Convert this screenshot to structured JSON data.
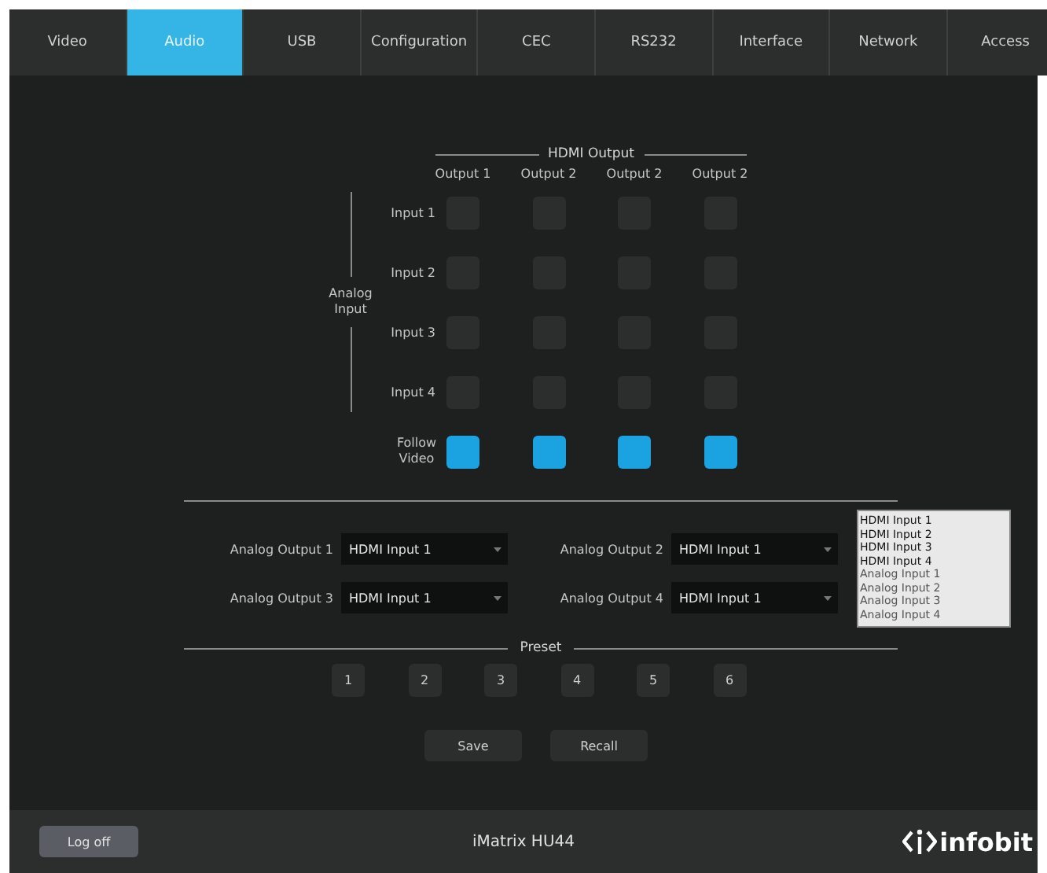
{
  "tabs": [
    {
      "label": "Video",
      "selected": false
    },
    {
      "label": "Audio",
      "selected": true
    },
    {
      "label": "USB",
      "selected": false
    },
    {
      "label": "Configuration",
      "selected": false
    },
    {
      "label": "CEC",
      "selected": false
    },
    {
      "label": "RS232",
      "selected": false
    },
    {
      "label": "Interface",
      "selected": false
    },
    {
      "label": "Network",
      "selected": false
    },
    {
      "label": "Access",
      "selected": false
    }
  ],
  "matrix": {
    "output_group": "HDMI Output",
    "input_group": "Analog Input",
    "outputs": [
      "Output 1",
      "Output 2",
      "Output 2",
      "Output 2"
    ],
    "rows": [
      {
        "label": "Input 1",
        "cells": [
          {
            "on": false
          },
          {
            "on": false
          },
          {
            "on": false
          },
          {
            "on": false
          }
        ]
      },
      {
        "label": "Input 2",
        "cells": [
          {
            "on": false
          },
          {
            "on": false
          },
          {
            "on": false
          },
          {
            "on": false
          }
        ]
      },
      {
        "label": "Input 3",
        "cells": [
          {
            "on": false
          },
          {
            "on": false
          },
          {
            "on": false
          },
          {
            "on": false
          }
        ]
      },
      {
        "label": "Input 4",
        "cells": [
          {
            "on": false
          },
          {
            "on": false
          },
          {
            "on": false
          },
          {
            "on": false
          }
        ]
      }
    ],
    "follow_video": {
      "label": "Follow Video",
      "cells": [
        {
          "on": true
        },
        {
          "on": true
        },
        {
          "on": true
        },
        {
          "on": true
        }
      ]
    }
  },
  "analog_outputs": [
    {
      "label": "Analog Output 1",
      "value": "HDMI Input 1"
    },
    {
      "label": "Analog Output 2",
      "value": "HDMI Input 1"
    },
    {
      "label": "Analog Output 3",
      "value": "HDMI Input 1"
    },
    {
      "label": "Analog Output 4",
      "value": "HDMI Input 1"
    }
  ],
  "open_list": [
    {
      "label": "HDMI Input 1",
      "disabled": false
    },
    {
      "label": "HDMI Input 2",
      "disabled": false
    },
    {
      "label": "HDMI Input 3",
      "disabled": false
    },
    {
      "label": "HDMI Input 4",
      "disabled": false
    },
    {
      "label": "Analog Input 1",
      "disabled": true
    },
    {
      "label": "Analog Input 2",
      "disabled": true
    },
    {
      "label": "Analog Input 3",
      "disabled": true
    },
    {
      "label": "Analog Input 4",
      "disabled": true
    }
  ],
  "preset": {
    "title": "Preset",
    "numbers": [
      "1",
      "2",
      "3",
      "4",
      "5",
      "6"
    ],
    "actions": [
      "Save",
      "Recall"
    ]
  },
  "footer": {
    "log_off": "Log off",
    "device": "iMatrix HU44",
    "brand": "infobit"
  }
}
